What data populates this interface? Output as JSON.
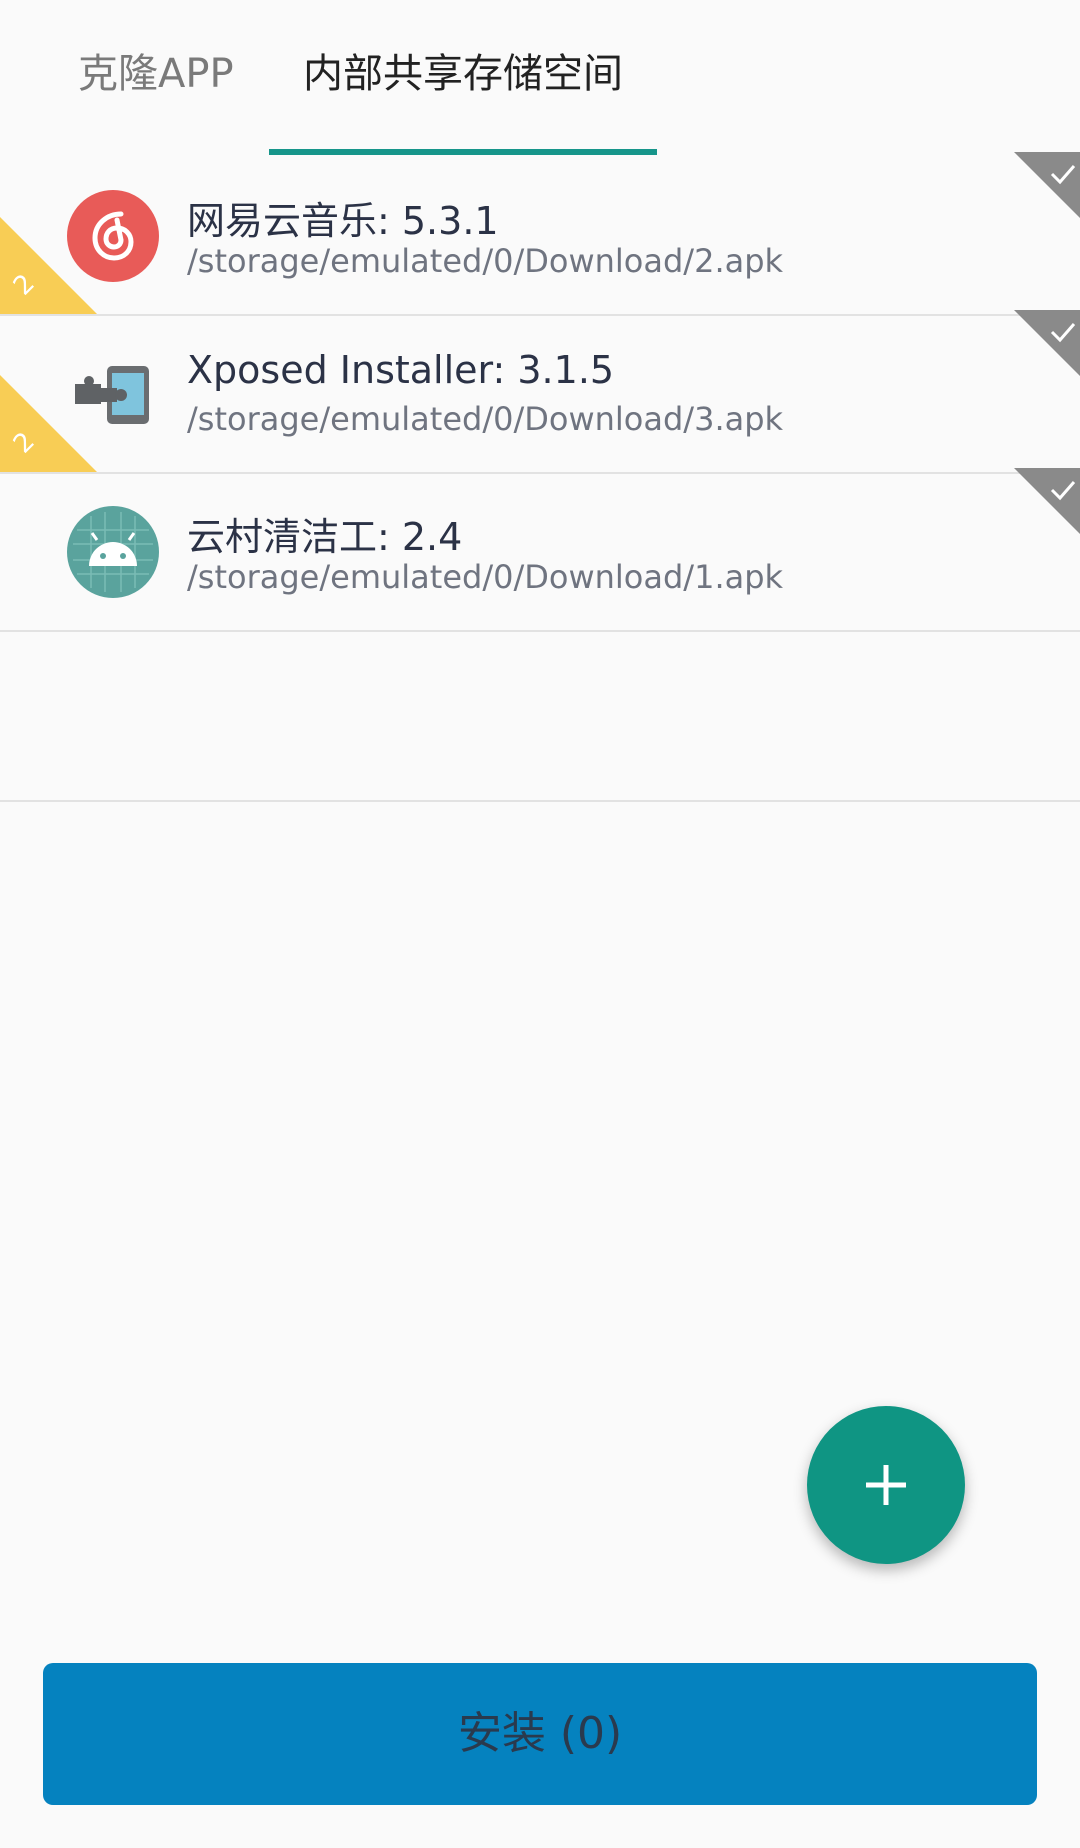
{
  "tabs": [
    {
      "label": "克隆APP"
    },
    {
      "label": "内部共享存储空间"
    }
  ],
  "active_tab_index": 1,
  "apps": [
    {
      "title": "网易云音乐: 5.3.1",
      "path": "/storage/emulated/0/Download/2.apk",
      "icon": "netease-cloud-music-icon",
      "badge": "2",
      "checked": true
    },
    {
      "title": "Xposed Installer: 3.1.5",
      "path": "/storage/emulated/0/Download/3.apk",
      "icon": "xposed-puzzle-icon",
      "badge": "2",
      "checked": true
    },
    {
      "title": "云村清洁工: 2.4",
      "path": "/storage/emulated/0/Download/1.apk",
      "icon": "android-icon",
      "checked": true
    }
  ],
  "fab": {
    "icon": "plus-icon"
  },
  "install_button": {
    "label": "安装 (0)"
  },
  "colors": {
    "accent": "#16958a",
    "fab": "#0f9583",
    "install_button": "#0582bf",
    "badge": "#f8cd55",
    "check_corner": "#8a8a8a"
  }
}
